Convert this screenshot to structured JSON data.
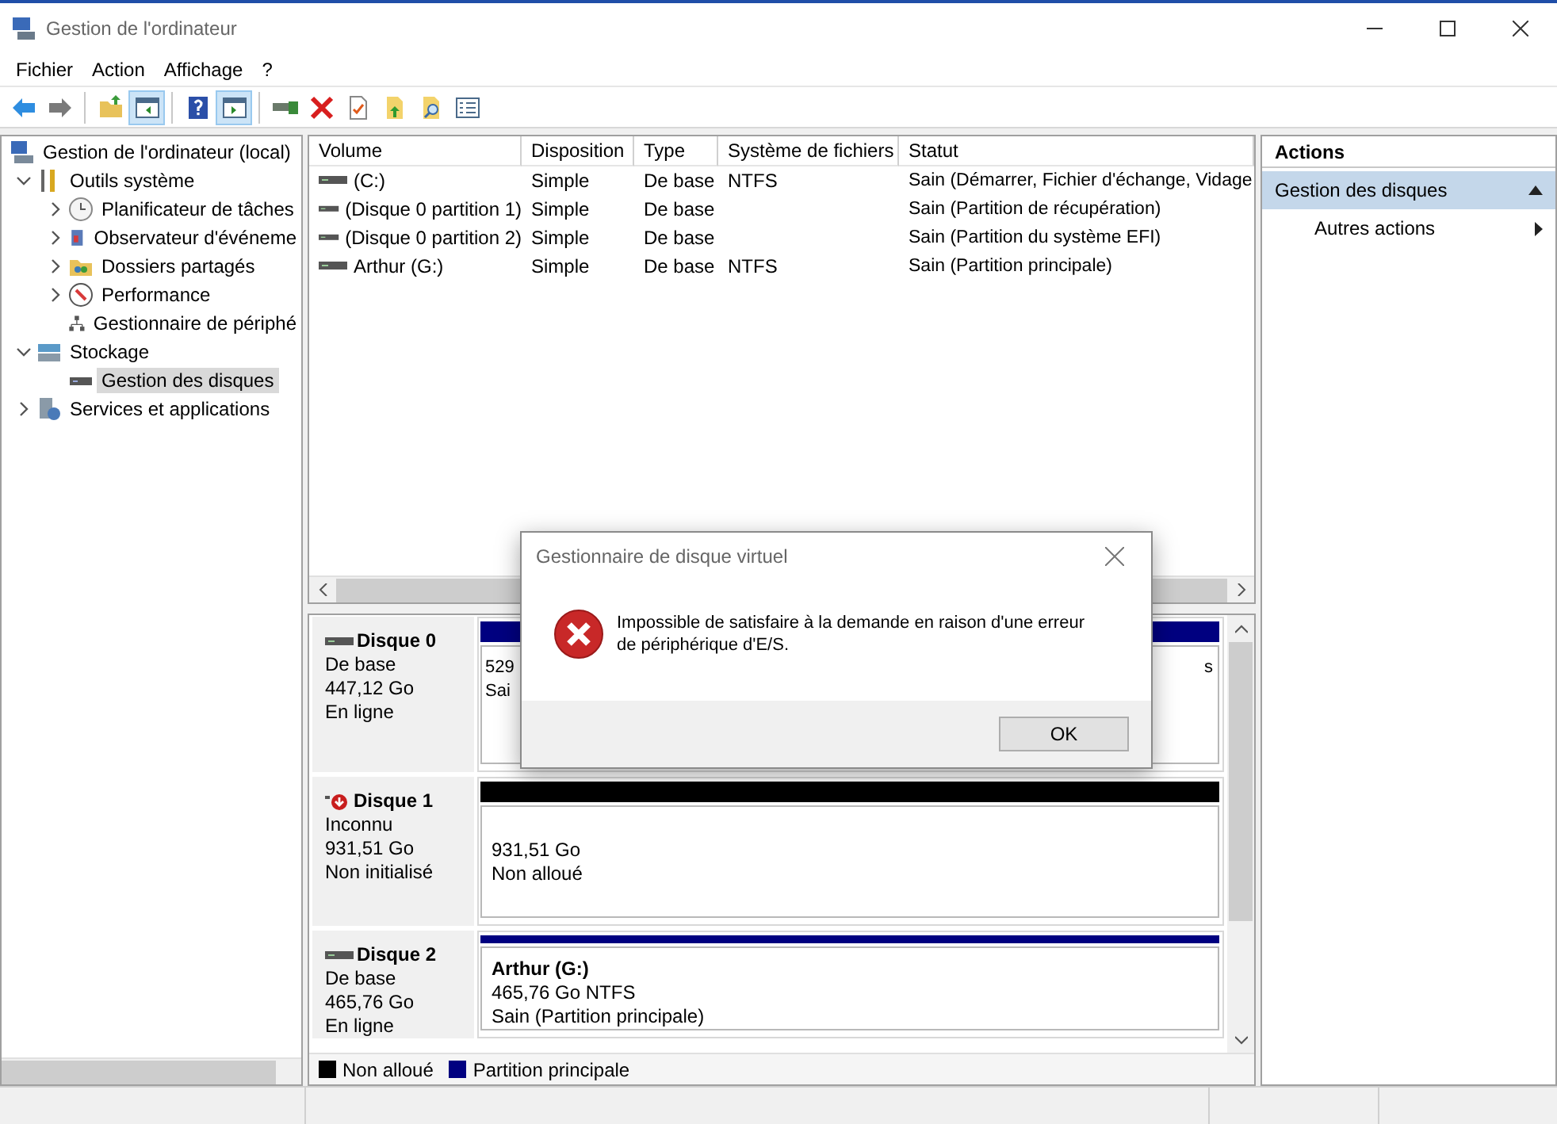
{
  "window": {
    "title": "Gestion de l'ordinateur"
  },
  "menu": [
    "Fichier",
    "Action",
    "Affichage",
    "?"
  ],
  "toolbar": [
    {
      "kind": "back",
      "pressed": false
    },
    {
      "kind": "forward",
      "pressed": false
    },
    {
      "kind": "separator"
    },
    {
      "kind": "up-folder",
      "pressed": false
    },
    {
      "kind": "tree-pane",
      "pressed": true
    },
    {
      "kind": "separator"
    },
    {
      "kind": "help",
      "pressed": false
    },
    {
      "kind": "action-pane",
      "pressed": true
    },
    {
      "kind": "separator"
    },
    {
      "kind": "connect",
      "pressed": false
    },
    {
      "kind": "delete",
      "pressed": false
    },
    {
      "kind": "properties",
      "pressed": false
    },
    {
      "kind": "export",
      "pressed": false
    },
    {
      "kind": "search",
      "pressed": false
    },
    {
      "kind": "list",
      "pressed": false
    }
  ],
  "tree": {
    "label": "Gestion de l'ordinateur (local)",
    "selected": false,
    "children": [
      {
        "label": "Outils système",
        "selected": false,
        "expanded": true,
        "children": [
          {
            "label": "Planificateur de tâches",
            "selected": false,
            "expanded": false
          },
          {
            "label": "Observateur d'événeme",
            "selected": false,
            "expanded": false
          },
          {
            "label": "Dossiers partagés",
            "selected": false,
            "expanded": false
          },
          {
            "label": "Performance",
            "selected": false,
            "expanded": false
          },
          {
            "label": "Gestionnaire de périphé",
            "selected": false
          }
        ]
      },
      {
        "label": "Stockage",
        "selected": false,
        "expanded": true,
        "children": [
          {
            "label": "Gestion des disques",
            "selected": true
          }
        ]
      },
      {
        "label": "Services et applications",
        "selected": false,
        "expanded": false
      }
    ]
  },
  "table": {
    "columns": [
      "Volume",
      "Disposition",
      "Type",
      "Système de fichiers",
      "Statut"
    ],
    "rows": [
      {
        "volume": "(C:)",
        "disposition": "Simple",
        "type": "De base",
        "file_system": "NTFS",
        "status": "Sain (Démarrer, Fichier d'échange, Vidage"
      },
      {
        "volume": "(Disque 0 partition 1)",
        "disposition": "Simple",
        "type": "De base",
        "status": "Sain (Partition de récupération)"
      },
      {
        "volume": "(Disque 0 partition 2)",
        "disposition": "Simple",
        "type": "De base",
        "status": "Sain (Partition du système EFI)"
      },
      {
        "volume": "Arthur (G:)",
        "disposition": "Simple",
        "type": "De base",
        "file_system": "NTFS",
        "status": "Sain (Partition principale)"
      }
    ]
  },
  "disks": [
    {
      "name": "Disque 0",
      "error": false,
      "info": [
        "De base",
        "447,12 Go",
        "En ligne"
      ],
      "partitions": [
        {
          "kind": "primary",
          "lines": [
            "529",
            "Sai"
          ]
        },
        {
          "kind": "primary",
          "lines": [
            "s"
          ]
        }
      ]
    },
    {
      "name": "Disque 1",
      "error": true,
      "info": [
        "Inconnu",
        "931,51 Go",
        "Non initialisé"
      ],
      "partitions": [
        {
          "kind": "unallocated",
          "lines": [
            "931,51 Go",
            "Non alloué"
          ]
        }
      ]
    },
    {
      "name": "Disque 2",
      "error": false,
      "info": [
        "De base",
        "465,76 Go",
        "En ligne"
      ],
      "partitions": [
        {
          "kind": "primary",
          "title": "Arthur  (G:)",
          "lines": [
            "465,76 Go NTFS",
            "Sain (Partition principale)"
          ]
        }
      ]
    }
  ],
  "legend": [
    {
      "label": "Non alloué",
      "color": "#000000"
    },
    {
      "label": "Partition principale",
      "color": "#000080"
    }
  ],
  "actions": {
    "title": "Actions",
    "sections": [
      {
        "label": "Gestion des disques",
        "expanded": true,
        "items": [
          "Autres actions"
        ]
      }
    ]
  },
  "dialog": {
    "title": "Gestionnaire de disque virtuel",
    "message": "Impossible de satisfaire à la demande en raison d'une erreur de périphérique d'E/S.",
    "buttons": [
      "OK"
    ]
  }
}
